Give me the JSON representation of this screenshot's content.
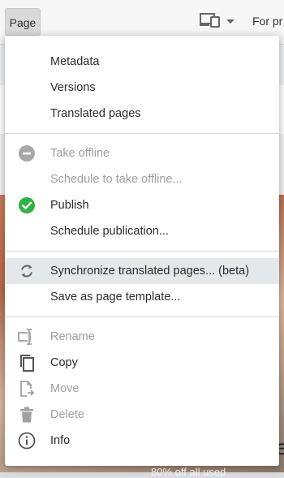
{
  "toolbar": {
    "page_button_label": "Page",
    "right_text": "For pr"
  },
  "menu": {
    "sections": [
      {
        "items": [
          {
            "label": "Metadata",
            "enabled": true
          },
          {
            "label": "Versions",
            "enabled": true
          },
          {
            "label": "Translated pages",
            "enabled": true
          }
        ]
      },
      {
        "items": [
          {
            "label": "Take offline",
            "enabled": false,
            "icon": "minus-circle-icon"
          },
          {
            "label": "Schedule to take offline...",
            "enabled": false
          },
          {
            "label": "Publish",
            "enabled": true,
            "icon": "check-circle-icon",
            "icon_color": "#2fb344"
          },
          {
            "label": "Schedule publication...",
            "enabled": true
          }
        ]
      },
      {
        "items": [
          {
            "label": "Synchronize translated pages... (beta)",
            "enabled": true,
            "icon": "sync-icon",
            "highlighted": true
          },
          {
            "label": "Save as page template...",
            "enabled": true
          }
        ]
      },
      {
        "items": [
          {
            "label": "Rename",
            "enabled": false,
            "icon": "rename-icon"
          },
          {
            "label": "Copy",
            "enabled": true,
            "icon": "copy-icon"
          },
          {
            "label": "Move",
            "enabled": false,
            "icon": "move-icon"
          },
          {
            "label": "Delete",
            "enabled": false,
            "icon": "trash-icon"
          },
          {
            "label": "Info",
            "enabled": true,
            "icon": "info-icon"
          }
        ]
      }
    ]
  },
  "background": {
    "fragment_e": "e",
    "bottom_text": "80% off all used"
  }
}
